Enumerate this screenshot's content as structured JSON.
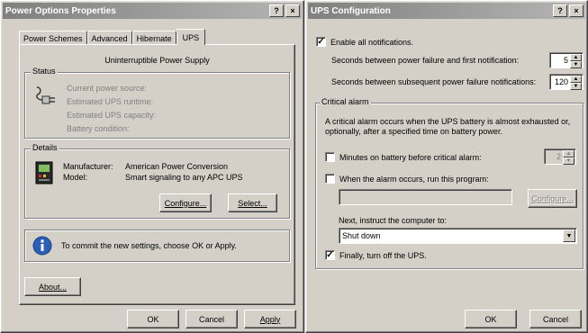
{
  "left_window": {
    "title": "Power Options Properties",
    "help_btn": "?",
    "close_btn": "×",
    "tabs": [
      "Power Schemes",
      "Advanced",
      "Hibernate",
      "UPS"
    ],
    "heading": "Uninterruptible Power Supply",
    "status": {
      "label": "Status",
      "lines": [
        "Current power source:",
        "Estimated UPS runtime:",
        "Estimated UPS capacity:",
        "Battery condition:"
      ]
    },
    "details": {
      "label": "Details",
      "manufacturer_label": "Manufacturer:",
      "manufacturer_value": "American Power Conversion",
      "model_label": "Model:",
      "model_value": "Smart signaling to any APC UPS",
      "configure_btn": "Configure...",
      "select_btn": "Select..."
    },
    "info_text": "To commit the new settings, choose OK or Apply.",
    "about_btn": "About...",
    "ok_btn": "OK",
    "cancel_btn": "Cancel",
    "apply_btn": "Apply"
  },
  "right_window": {
    "title": "UPS Configuration",
    "help_btn": "?",
    "close_btn": "×",
    "enable_notifications": "Enable all notifications.",
    "first_notification_label": "Seconds between power failure and first notification:",
    "first_notification_value": "5",
    "subsequent_label": "Seconds between subsequent power failure notifications:",
    "subsequent_value": "120",
    "critical": {
      "label": "Critical alarm",
      "desc_line1": "A critical alarm occurs when the UPS battery is almost exhausted or,",
      "desc_line2": "optionally, after a specified time on battery power.",
      "minutes_label": "Minutes on battery before critical alarm:",
      "minutes_value": "2",
      "run_program_label": "When the alarm occurs, run this program:",
      "configure_btn": "Configure...",
      "next_instruct_label": "Next, instruct the computer to:",
      "action_value": "Shut down",
      "turn_off_label": "Finally, turn off the UPS."
    },
    "ok_btn": "OK",
    "cancel_btn": "Cancel"
  },
  "check_mark": "✓",
  "spin_up": "▲",
  "spin_down": "▼",
  "icons": {
    "ups_plug": "plug-icon",
    "ups_battery": "ups-device-icon",
    "info": "info-icon"
  }
}
